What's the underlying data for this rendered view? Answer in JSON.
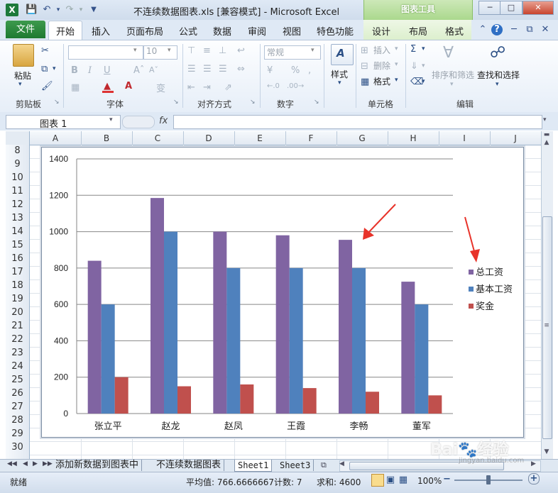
{
  "window": {
    "title": "不连续数据图表.xls  [兼容模式] - Microsoft Excel",
    "context_group": "图表工具",
    "app_icon": "X"
  },
  "quick_access": {
    "save": "save-icon",
    "undo": "undo-icon",
    "redo": "redo-icon"
  },
  "tabs": {
    "file": "文件",
    "items": [
      "开始",
      "插入",
      "页面布局",
      "公式",
      "数据",
      "审阅",
      "视图",
      "特色功能",
      "设计",
      "布局",
      "格式"
    ]
  },
  "ribbon": {
    "clipboard": {
      "paste": "粘贴",
      "label": "剪贴板"
    },
    "font": {
      "size": "10",
      "bold": "B",
      "italic": "I",
      "underline": "U",
      "label": "字体"
    },
    "align": {
      "label": "对齐方式"
    },
    "number": {
      "format": "常规",
      "label": "数字"
    },
    "style": {
      "styles": "样式"
    },
    "cells": {
      "insert": "插入",
      "delete": "删除",
      "format": "格式",
      "label": "单元格"
    },
    "editing": {
      "sort_filter": "排序和筛选",
      "find_select": "查找和选择",
      "label": "编辑"
    }
  },
  "formula_bar": {
    "name_box": "图表 1",
    "fx": "fx"
  },
  "columns": [
    "A",
    "B",
    "C",
    "D",
    "E",
    "F",
    "G",
    "H",
    "I",
    "J"
  ],
  "rows": [
    "8",
    "9",
    "10",
    "11",
    "12",
    "13",
    "14",
    "15",
    "16",
    "17",
    "18",
    "19",
    "20",
    "21",
    "22",
    "23",
    "24",
    "25",
    "26",
    "27",
    "28",
    "29",
    "30"
  ],
  "chart_data": {
    "type": "bar",
    "categories": [
      "张立平",
      "赵龙",
      "赵凤",
      "王霞",
      "李畅",
      "董军"
    ],
    "series": [
      {
        "name": "总工资",
        "values": [
          840,
          1185,
          1000,
          980,
          955,
          725
        ],
        "color": "#8064a2"
      },
      {
        "name": "基本工资",
        "values": [
          600,
          1000,
          800,
          800,
          800,
          600
        ],
        "color": "#4f81bd"
      },
      {
        "name": "奖金",
        "values": [
          200,
          150,
          160,
          140,
          120,
          100
        ],
        "color": "#c0504d"
      }
    ],
    "ylim": [
      0,
      1400
    ],
    "yticks": [
      "0",
      "200",
      "400",
      "600",
      "800",
      "1000",
      "1200",
      "1400"
    ],
    "grid": true,
    "legend": "right"
  },
  "sheet_tabs": [
    "添加新数据到图表中",
    "不连续数据图表",
    "Sheet1",
    "Sheet3"
  ],
  "status": {
    "ready": "就绪",
    "average": "平均值: 766.6666667",
    "count": "计数: 7",
    "sum": "求和: 4600",
    "zoom": "100%"
  },
  "watermark": {
    "logo": "Bai du 经验",
    "url": "jingyan.baidu.com"
  }
}
